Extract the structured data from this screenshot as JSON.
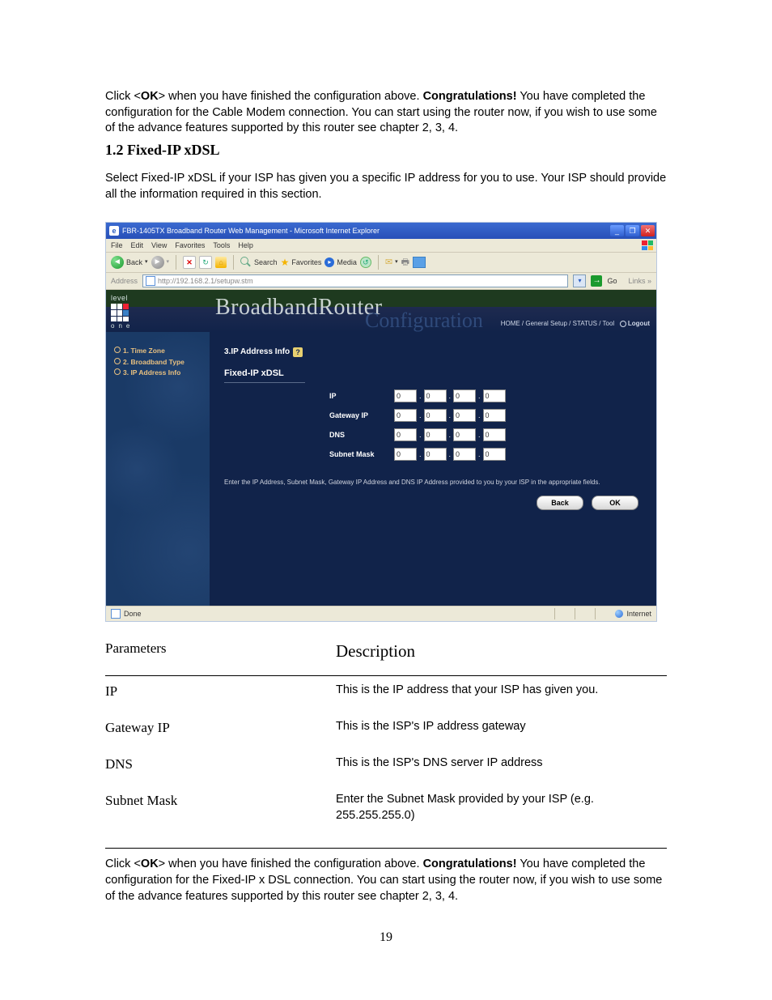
{
  "intro1": {
    "pre": "Click <",
    "ok": "OK",
    "mid": "> when you have finished the configuration above. ",
    "congrats": "Congratulations!",
    "post": " You have completed the configuration for the Cable Modem connection. You can start using the router now, if you wish to use some of the advance features supported by this router see chapter 2, 3, 4."
  },
  "section_heading": "1.2 Fixed-IP xDSL",
  "section_para": "Select Fixed-IP xDSL if your ISP has given you a specific IP address for you to use. Your ISP should provide all the information required in this section.",
  "ie": {
    "title": "FBR-1405TX Broadband Router Web Management - Microsoft Internet Explorer",
    "menu": [
      "File",
      "Edit",
      "View",
      "Favorites",
      "Tools",
      "Help"
    ],
    "back": "Back",
    "search": "Search",
    "favorites": "Favorites",
    "media": "Media",
    "addr_label": "Address",
    "addr_value": "http://192.168.2.1/setupw.stm",
    "go": "Go",
    "links": "Links",
    "status_done": "Done",
    "status_zone": "Internet"
  },
  "router": {
    "brand_top": "level",
    "brand_bottom": "one",
    "title": "BroadbandRouter",
    "subtitle": "Configuration",
    "topnav": [
      "HOME",
      "General Setup",
      "STATUS",
      "Tool"
    ],
    "logout": "Logout",
    "sidebar": [
      "1. Time Zone",
      "2. Broadband Type",
      "3. IP Address Info"
    ],
    "panel_title": "3.IP Address Info",
    "panel_sub": "Fixed-IP xDSL",
    "fields": {
      "ip": "IP",
      "gw": "Gateway IP",
      "dns": "DNS",
      "mask": "Subnet Mask"
    },
    "octet": "0",
    "hint": "Enter the IP Address, Subnet Mask, Gateway IP Address and DNS IP Address provided to you by your ISP in the appropriate fields.",
    "btn_back": "Back",
    "btn_ok": "OK"
  },
  "params": {
    "head_p": "Parameters",
    "head_d": "Description",
    "rows": [
      {
        "p": "IP",
        "d": "This is the IP address that your ISP has given you."
      },
      {
        "p": "Gateway IP",
        "d": "This is the ISP's IP address gateway"
      },
      {
        "p": "DNS",
        "d": "This is the ISP's DNS server IP address"
      },
      {
        "p": "Subnet Mask",
        "d": "Enter the Subnet Mask provided by your ISP (e.g. 255.255.255.0)"
      }
    ]
  },
  "outro": {
    "pre": "Click <",
    "ok": "OK",
    "mid": "> when you have finished the configuration above. ",
    "congrats": "Congratulations!",
    "post": " You have completed the configuration for the Fixed-IP x DSL connection. You can start using the router now, if you wish to use some of the advance features supported by this router see chapter 2, 3, 4."
  },
  "page_number": "19"
}
